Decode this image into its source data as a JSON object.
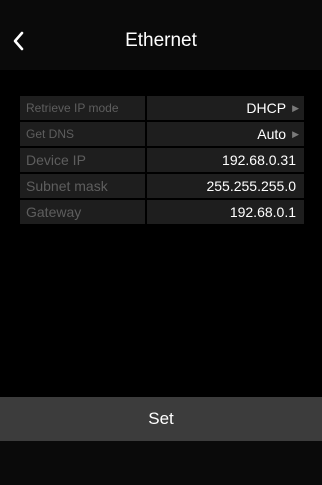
{
  "header": {
    "title": "Ethernet",
    "back_icon": "chevron-left-icon"
  },
  "settings": {
    "rows": [
      {
        "label": "Retrieve IP mode",
        "value": "DHCP",
        "selectable": true
      },
      {
        "label": "Get DNS",
        "value": "Auto",
        "selectable": true
      },
      {
        "label": "Device IP",
        "value": "192.68.0.31",
        "selectable": false
      },
      {
        "label": "Subnet mask",
        "value": "255.255.255.0",
        "selectable": false
      },
      {
        "label": "Gateway",
        "value": "192.68.0.1",
        "selectable": false
      }
    ]
  },
  "footer": {
    "set_label": "Set"
  },
  "colors": {
    "background": "#000000",
    "cell": "#1e1e1e",
    "label_text": "#5e5e5e",
    "button": "#3c3c3c",
    "arrow": "#7a7a7a"
  }
}
